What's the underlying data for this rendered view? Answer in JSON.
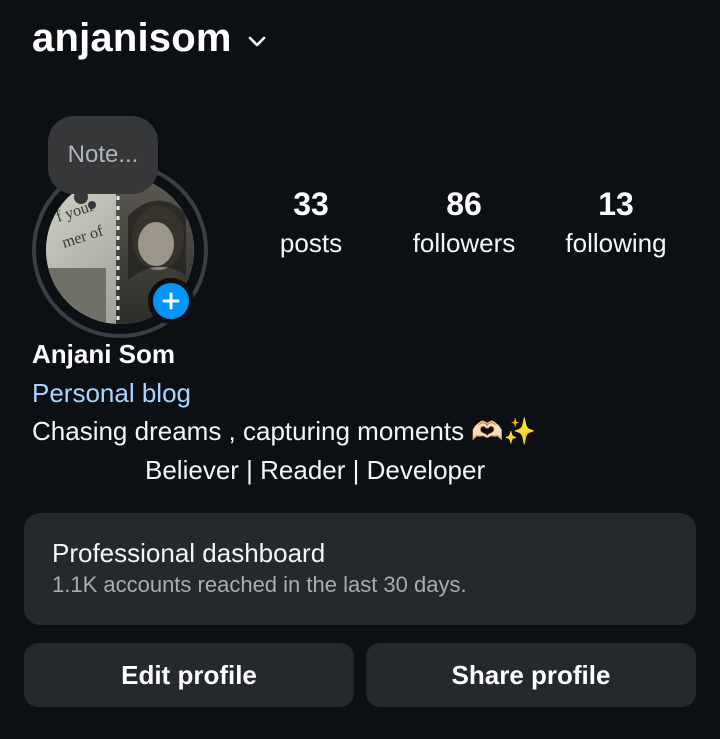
{
  "header": {
    "username": "anjanisom",
    "switch_icon": "chevron-down-icon"
  },
  "note": {
    "placeholder": "Note..."
  },
  "avatar": {
    "badge_icon": "plus-icon",
    "badge_color": "#0095f6"
  },
  "stats": [
    {
      "value": "33",
      "label": "posts"
    },
    {
      "value": "86",
      "label": "followers"
    },
    {
      "value": "13",
      "label": "following"
    }
  ],
  "bio": {
    "name": "Anjani Som",
    "category": "Personal blog",
    "line1": "Chasing dreams , capturing moments 🫶🏻✨",
    "line2": "Believer | Reader | Developer"
  },
  "dashboard": {
    "title": "Professional dashboard",
    "subtitle": "1.1K accounts reached in the last 30 days."
  },
  "actions": {
    "edit_label": "Edit profile",
    "share_label": "Share profile"
  },
  "colors": {
    "background": "#0c1014",
    "card": "#25292e",
    "link": "#a8d4ff",
    "accent": "#0095f6"
  }
}
